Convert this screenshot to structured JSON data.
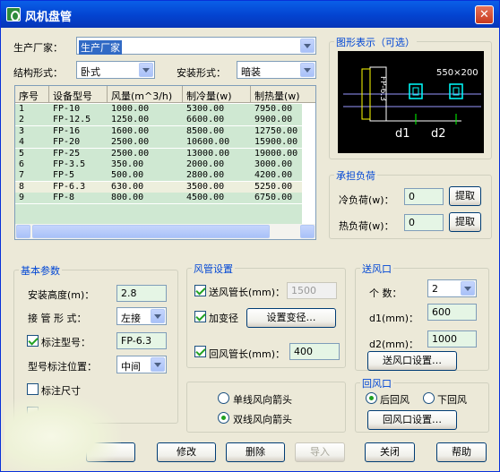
{
  "window": {
    "title": "风机盘管"
  },
  "manufacturer": {
    "label": "生产厂家：",
    "value": "生产厂家"
  },
  "structure": {
    "label": "结构形式：",
    "value": "卧式"
  },
  "install_form": {
    "label": "安装形式：",
    "value": "暗装"
  },
  "table": {
    "headers": [
      "序号",
      "设备型号",
      "风量(m^3/h)",
      "制冷量(w)",
      "制热量(w)"
    ],
    "rows": [
      [
        "1",
        "FP-10",
        "1000.00",
        "5300.00",
        "7950.00"
      ],
      [
        "2",
        "FP-12.5",
        "1250.00",
        "6600.00",
        "9900.00"
      ],
      [
        "3",
        "FP-16",
        "1600.00",
        "8500.00",
        "12750.00"
      ],
      [
        "4",
        "FP-20",
        "2500.00",
        "10600.00",
        "15900.00"
      ],
      [
        "5",
        "FP-25",
        "2500.00",
        "13000.00",
        "19000.00"
      ],
      [
        "6",
        "FP-3.5",
        "350.00",
        "2000.00",
        "3000.00"
      ],
      [
        "7",
        "FP-5",
        "500.00",
        "2800.00",
        "4200.00"
      ],
      [
        "8",
        "FP-6.3",
        "630.00",
        "3500.00",
        "5250.00"
      ],
      [
        "9",
        "FP-8",
        "800.00",
        "4500.00",
        "6750.00"
      ]
    ],
    "selected_row": 7
  },
  "preview": {
    "title": "图形表示（可选）",
    "dim_label": "550×200",
    "unit_label": "FP-6.3",
    "d1": "d1",
    "d2": "d2"
  },
  "load": {
    "title": "承担负荷",
    "cold_label": "冷负荷(w)：",
    "cold_value": "0",
    "cold_btn": "提取",
    "heat_label": "热负荷(w)：",
    "heat_value": "0",
    "heat_btn": "提取"
  },
  "basic": {
    "title": "基本参数",
    "height_label": "安装高度(m)：",
    "height_value": "2.8",
    "connect_label": "接 管 形 式：",
    "connect_value": "左接",
    "mark_model_label": "标注型号：",
    "mark_model_value": "FP-6.3",
    "mark_pos_label": "型号标注位置：",
    "mark_pos_value": "中间",
    "mark_size_label": "标注尺寸"
  },
  "duct": {
    "title": "风管设置",
    "supply_label": "送风管长(mm)：",
    "supply_value": "1500",
    "reducer_label": "加变径",
    "reducer_btn": "设置变径…",
    "return_label": "回风管长(mm)：",
    "return_value": "400"
  },
  "arrow": {
    "single_label": "单线风向箭头",
    "double_label": "双线风向箭头"
  },
  "supply_outlet": {
    "title": "送风口",
    "count_label": "个 数：",
    "count_value": "2",
    "d1_label": "d1(mm)：",
    "d1_value": "600",
    "d2_label": "d2(mm)：",
    "d2_value": "1000",
    "btn": "送风口设置…"
  },
  "return_outlet": {
    "title": "回风口",
    "rear_label": "后回风",
    "bottom_label": "下回风",
    "btn": "回风口设置…"
  },
  "buttons": {
    "modify": "修改",
    "delete": "删除",
    "import": "导入",
    "close": "关闭",
    "help": "帮助"
  }
}
